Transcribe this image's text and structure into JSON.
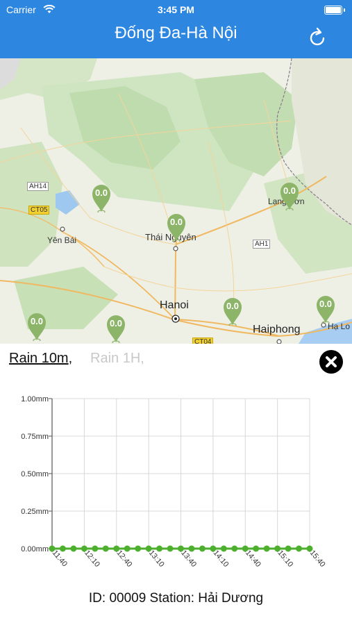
{
  "status_bar": {
    "carrier": "Carrier",
    "time": "3:45 PM"
  },
  "header": {
    "title": "Đống Đa-Hà Nội",
    "refresh_icon": "refresh-icon"
  },
  "map": {
    "places": [
      {
        "name": "Thái Nguyên"
      },
      {
        "name": "Yên Bái"
      },
      {
        "name": "Hanoi"
      },
      {
        "name": "Haiphong"
      },
      {
        "name": "Lạng Sơn"
      },
      {
        "name": "Hạ Lo"
      }
    ],
    "roads": [
      "AH14",
      "CT05",
      "AH1",
      "CT04"
    ],
    "markers": [
      {
        "value": "0.0"
      },
      {
        "value": "0.0"
      },
      {
        "value": "0.0"
      },
      {
        "value": "0.0"
      },
      {
        "value": "0.0"
      },
      {
        "value": "0.0"
      },
      {
        "value": "0.0"
      }
    ]
  },
  "panel": {
    "tabs": [
      {
        "label": "Rain 10m",
        "suffix": ",",
        "active": true
      },
      {
        "label": "Rain 1H",
        "suffix": ",",
        "active": false
      }
    ],
    "close_icon": "close-icon",
    "station_text": "ID: 00009 Station: Hải Dương"
  },
  "chart_data": {
    "type": "line",
    "x": [
      "11:40",
      "11:50",
      "12:00",
      "12:10",
      "12:20",
      "12:30",
      "12:40",
      "12:50",
      "13:00",
      "13:10",
      "13:20",
      "13:30",
      "13:40",
      "13:50",
      "14:00",
      "14:10",
      "14:20",
      "14:30",
      "14:40",
      "14:50",
      "15:00",
      "15:10",
      "15:20",
      "15:30",
      "15:40"
    ],
    "tick_labels_x": [
      "11:40",
      "12:10",
      "12:40",
      "13:10",
      "13:40",
      "14:10",
      "14:40",
      "15:10",
      "15:40"
    ],
    "series": [
      {
        "values": [
          0,
          0,
          0,
          0,
          0,
          0,
          0,
          0,
          0,
          0,
          0,
          0,
          0,
          0,
          0,
          0,
          0,
          0,
          0,
          0,
          0,
          0,
          0,
          0,
          0
        ]
      }
    ],
    "ylim": [
      0,
      1
    ],
    "y_ticks": [
      "0.00mm",
      "0.25mm",
      "0.50mm",
      "0.75mm",
      "1.00mm"
    ],
    "grid": true,
    "color": "#4caf2e"
  }
}
